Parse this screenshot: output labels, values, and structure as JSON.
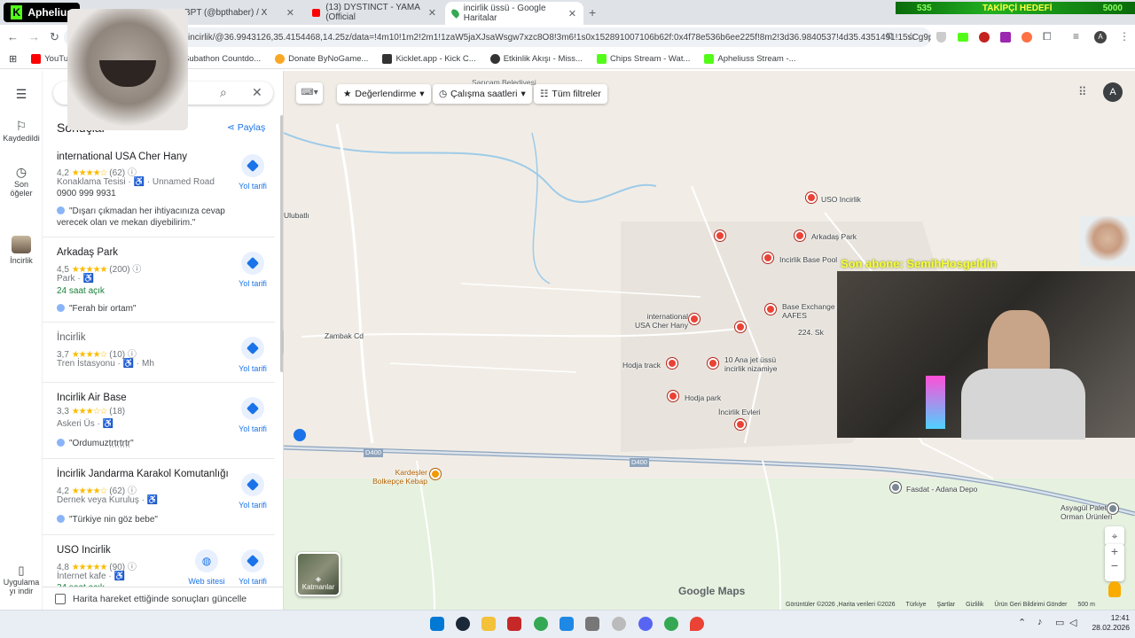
{
  "tabs": [
    {
      "label": "Aphelius"
    },
    {
      "label": "BPT (@bpthaber) / X"
    },
    {
      "label": "(13) DYSTINCT - YAMA (Official"
    },
    {
      "label": "incirlik üssü - Google Haritalar"
    }
  ],
  "stream": {
    "follow_goal_label": "TAKİPÇİ HEDEFİ",
    "follow_current": "535",
    "follow_target": "5000",
    "last_sub": "Son abone: SemihHosgeldin"
  },
  "omnibox": {
    "url": "incirlik/@36.9943126,35.4154468,14.25z/data=!4m10!1m2!2m1!1zaW5jaXJsaWsgw7xzc8O8!3m6!1s0x152891007106b62f:0x4f78e536b6ee225f!8m2!3d36.9840537!4d35.4351491!15sCg9pbm..."
  },
  "bookmarks": [
    "YouTu",
    "Subathon Countdo...",
    "Donate ByNoGame...",
    "Kicklet.app - Kick C...",
    "Etkinlik Akışı - Miss...",
    "Chips Stream - Wat...",
    "Apheliuss Stream -..."
  ],
  "rail": {
    "saved": "Kaydedildi",
    "recent": "Son öğeler",
    "place": "İncirlik",
    "apps": "Uygulama yı indir"
  },
  "panel": {
    "heading": "Sonuçlar",
    "share": "Paylaş",
    "update_label": "Harita hareket ettiğinde sonuçları güncelle",
    "directions": "Yol tarifi",
    "website": "Web sitesi",
    "results": [
      {
        "name": "international USA Cher Hany",
        "rating": "4,2",
        "stars": "★★★★☆",
        "count": "(62)",
        "cat": "Konaklama Tesisi · ♿ · Unnamed Road",
        "extra": "0900 999 9931",
        "review": "\"Dışarı çıkmadan her ihtiyacınıza cevap verecek olan ve mekan diyebilirim.\""
      },
      {
        "name": "Arkadaş Park",
        "rating": "4,5",
        "stars": "★★★★★",
        "count": "(200)",
        "cat": "Park · ♿",
        "extra": "24 saat açık",
        "review": "\"Ferah bir ortam\""
      },
      {
        "name": "İncirlik",
        "rating": "3,7",
        "stars": "★★★★☆",
        "count": "(10)",
        "cat": "Tren İstasyonu · ♿ · Mh",
        "extra": "",
        "review": ""
      },
      {
        "name": "Incirlik Air Base",
        "rating": "3,3",
        "stars": "★★★☆☆",
        "count": "(18)",
        "cat": "Askeri Üs · ♿",
        "extra": "",
        "review": "\"Ordumuzṭṛṭṛṭṛṭṛ\""
      },
      {
        "name": "İncirlik Jandarma Karakol Komutanlığı",
        "rating": "4,2",
        "stars": "★★★★☆",
        "count": "(62)",
        "cat": "Dernek veya Kuruluş · ♿",
        "extra": "",
        "review": "\"Türkiye nin göz bebe\""
      },
      {
        "name": "USO Incirlik",
        "rating": "4,8",
        "stars": "★★★★★",
        "count": "(90)",
        "cat": "İnternet kafe · ♿",
        "extra": "24 saat açık",
        "review": ""
      }
    ]
  },
  "map": {
    "filters": [
      "Değerlendirme",
      "Çalışma saatleri",
      "Tüm filtreler"
    ],
    "labels": {
      "saricam": "Sarıçam Belediyesi",
      "ulubatli": "Ulubatlı",
      "zambak": "Zambak Cd",
      "uso": "USO Incirlik",
      "arkadas": "Arkadaş Park",
      "pool": "Incirlik Base Pool",
      "bx": "Base Exchange AAFES",
      "cher": "international USA Cher Hany",
      "hodja_track": "Hodja track",
      "jet": "10 Ana jet üssü incirlik nizamiye",
      "hodja_park": "Hodja park",
      "evleri": "İncirlik Evleri",
      "kebap": "Kardeşler Bolkepçe Kebap",
      "depo": "Fasdat - Adana Depo",
      "asyagul": "Asyagül Palet Orman Ürünleri",
      "road": "D400",
      "ekmek": "224. Sk"
    },
    "layers": "Katmanlar",
    "logo": "Google Maps",
    "footer": [
      "Görüntüler ©2026 ,Harita verileri ©2026",
      "Türkiye",
      "Şartlar",
      "Gizlilik",
      "Ürün Geri Bildirimi Gönder",
      "500 m"
    ],
    "avatar": "A"
  },
  "clock": {
    "time": "12:41",
    "date": "28.02.2026"
  },
  "colors": {
    "accent": "#1a73e8",
    "pin": "#ea4335",
    "kick": "#53fc18"
  }
}
